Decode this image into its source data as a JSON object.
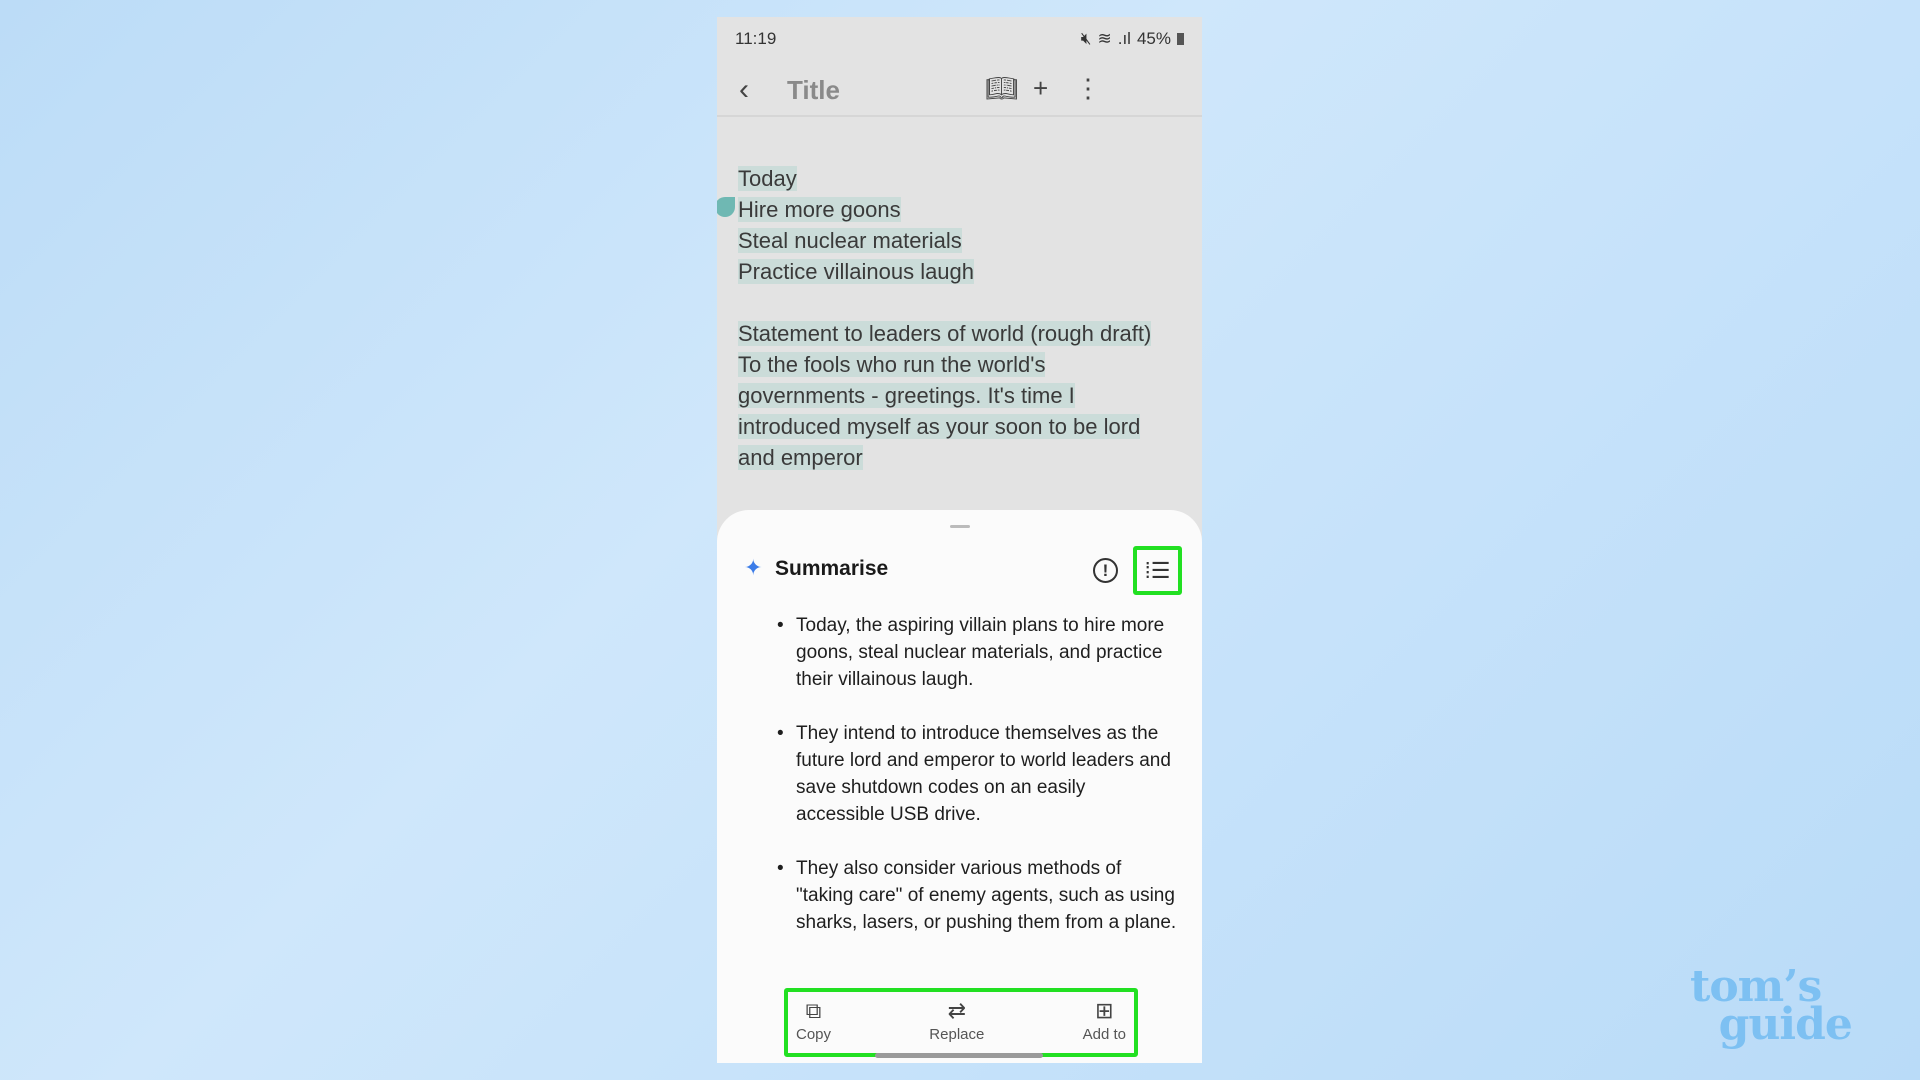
{
  "status_bar": {
    "time": "11:19",
    "battery": "45%",
    "icons": [
      "mute-icon",
      "wifi-icon",
      "signal-icon",
      "battery-icon"
    ]
  },
  "header": {
    "title": "Title",
    "icons": [
      "back-icon",
      "book-icon",
      "plus-icon",
      "more-icon"
    ]
  },
  "note": {
    "lines": [
      "Today",
      "Hire more goons",
      "Steal nuclear materials",
      "Practice villainous laugh",
      "",
      "Statement to leaders of world (rough draft)",
      "To the fools who run the world's",
      "governments - greetings. It's time I",
      "introduced myself as your soon to be lord",
      "and emperor"
    ]
  },
  "summary": {
    "title": "Summarise",
    "bullets": [
      "Today, the aspiring villain plans to hire more goons, steal nuclear materials, and practice their villainous laugh.",
      "They intend to introduce themselves as the future lord and emperor to world leaders and save shutdown codes on an easily accessible USB drive.",
      "They also consider various methods of \"taking care\" of enemy agents, such as using sharks, lasers, or pushing them from a plane."
    ],
    "actions": [
      {
        "label": "Copy",
        "icon": "copy-icon"
      },
      {
        "label": "Replace",
        "icon": "replace-icon"
      },
      {
        "label": "Add to",
        "icon": "add-to-icon"
      }
    ]
  },
  "highlight_color": "#22e022",
  "watermark": "tom's guide"
}
